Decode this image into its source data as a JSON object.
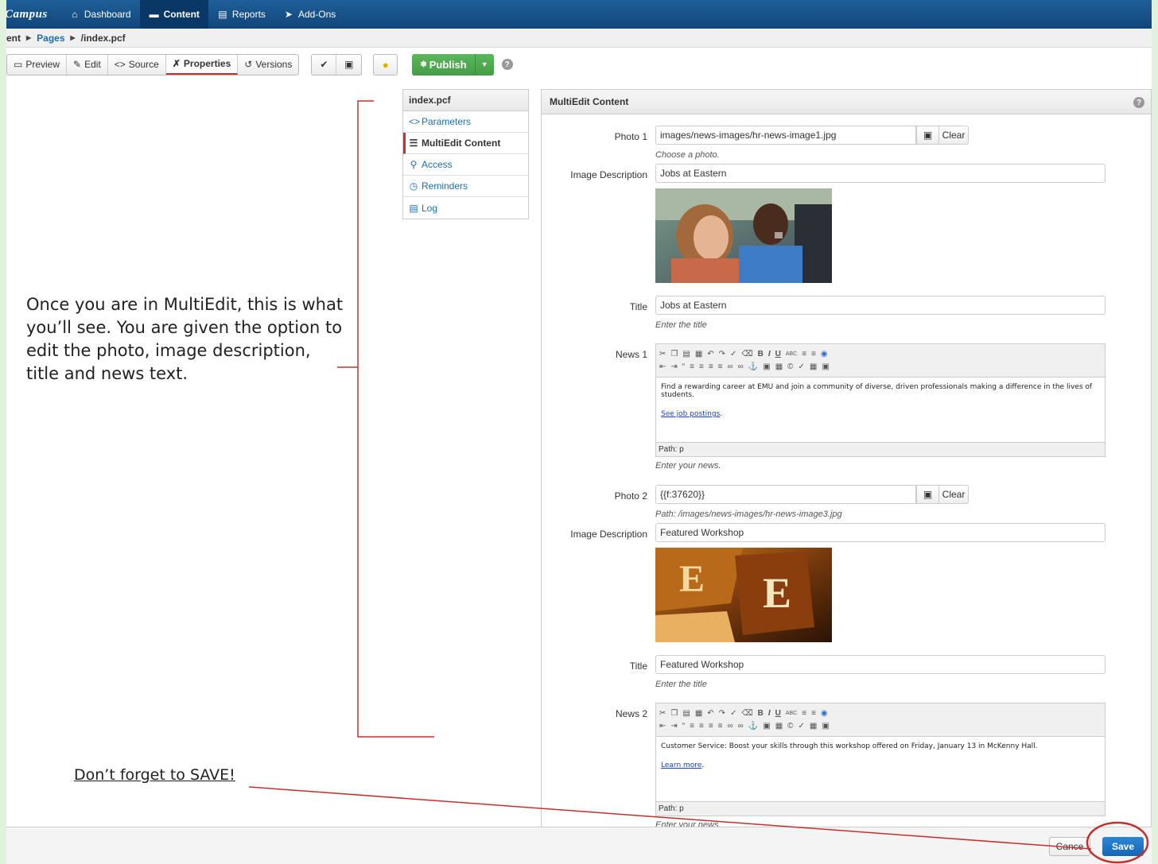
{
  "nav": {
    "brand": "Campus",
    "items": [
      {
        "label": "Dashboard",
        "icon": "home-icon"
      },
      {
        "label": "Content",
        "icon": "folder-icon"
      },
      {
        "label": "Reports",
        "icon": "clipboard-icon"
      },
      {
        "label": "Add-Ons",
        "icon": "pushpin-icon"
      }
    ]
  },
  "breadcrumb": {
    "items": [
      "ent",
      "Pages",
      "/index.pcf"
    ]
  },
  "toolbar": {
    "preview": "Preview",
    "edit": "Edit",
    "source": "Source",
    "properties": "Properties",
    "versions": "Versions",
    "publish": "Publish"
  },
  "sidetabs": {
    "header": "index.pcf",
    "items": [
      {
        "label": "Parameters",
        "icon": "code-icon"
      },
      {
        "label": "MultiEdit Content",
        "icon": "list-icon"
      },
      {
        "label": "Access",
        "icon": "key-icon"
      },
      {
        "label": "Reminders",
        "icon": "alarm-clock-icon"
      },
      {
        "label": "Log",
        "icon": "log-icon"
      }
    ]
  },
  "panel": {
    "title": "MultiEdit Content",
    "photo1": {
      "label": "Photo 1",
      "value": "images/news-images/hr-news-image1.jpg",
      "hint": "Choose a photo.",
      "clear": "Clear"
    },
    "desc1": {
      "label": "Image Description",
      "value": "Jobs at Eastern"
    },
    "title1": {
      "label": "Title",
      "value": "Jobs at Eastern",
      "hint": "Enter the title"
    },
    "news1": {
      "label": "News 1",
      "text": "Find a rewarding career at EMU and join a community of diverse, driven professionals making a difference in the lives of students.",
      "link": "See job postings",
      "path": "Path: p",
      "hint": "Enter your news."
    },
    "photo2": {
      "label": "Photo 2",
      "value": "{{f:37620}}",
      "hint": "Path: /images/news-images/hr-news-image3.jpg",
      "clear": "Clear"
    },
    "desc2": {
      "label": "Image Description",
      "value": "Featured Workshop"
    },
    "title2": {
      "label": "Title",
      "value": "Featured Workshop",
      "hint": "Enter the title"
    },
    "news2": {
      "label": "News 2",
      "text": "Customer Service: Boost your skills through this workshop offered on Friday, January 13 in McKenny Hall.",
      "link": "Learn more",
      "path": "Path: p",
      "hint": "Enter your news."
    }
  },
  "footer": {
    "cancel": "Cance",
    "save": "Save"
  },
  "annotations": {
    "main": "Once you are in MultiEdit, this is what you’ll see. You are given the option to edit the photo, image description, title and news text.",
    "save": "Don’t forget to SAVE!"
  },
  "colors": {
    "nav": "#10467a",
    "publish": "#449d44",
    "save": "#1565b5",
    "callout": "#c43030"
  }
}
